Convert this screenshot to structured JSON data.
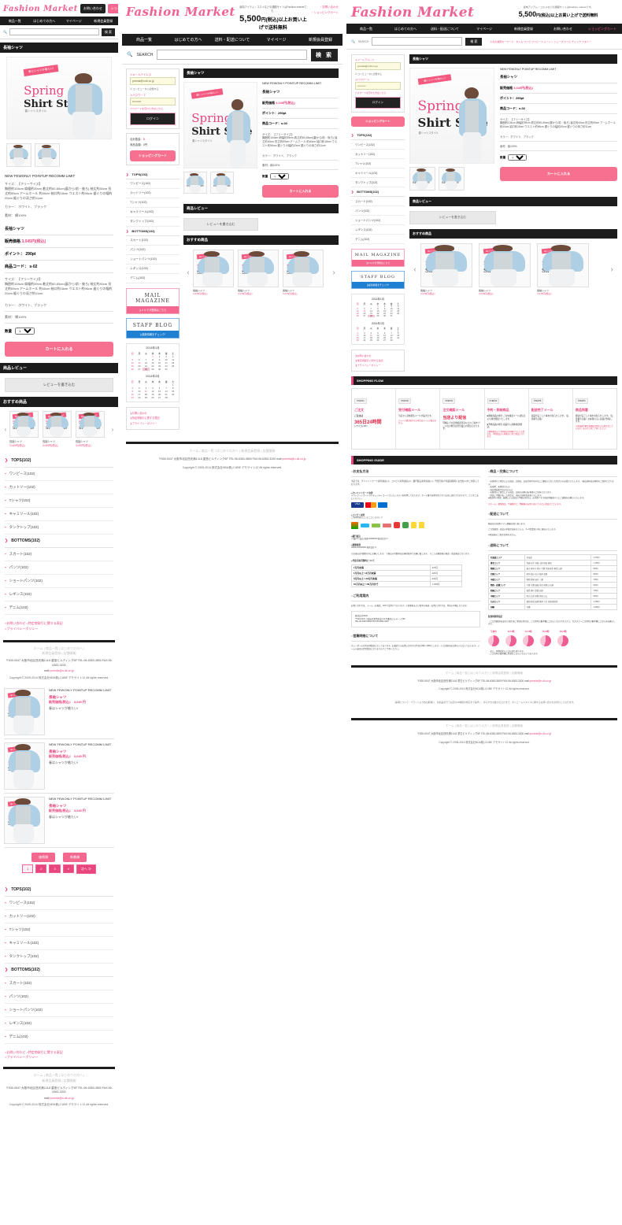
{
  "site": {
    "logo": "Fashion Market",
    "tagline": "最旬アイテム・コスメなどの通販サイトはFashion marketです。",
    "free_shipping_prefix": "5,500",
    "free_shipping_suffix": "円(税込)以上お買い上げで送料無料",
    "contact_link": "お問い合わせ",
    "cart_link": "ショッピングカート"
  },
  "nav": {
    "items_narrow": [
      "商品一覧",
      "はじめての方へ",
      "マイページ",
      "新規会員登録"
    ],
    "items_mid": [
      "商品一覧",
      "はじめての方へ",
      "送料・配送について",
      "マイページ",
      "新規会員登録"
    ],
    "items_wide": [
      "商品一覧",
      "はじめての方へ",
      "送料・配送について",
      "マイページ",
      "新規会員登録",
      "お問い合わせ",
      "ショッピングカート"
    ]
  },
  "search": {
    "label": "SEARCH",
    "placeholder": "",
    "button": "検 索",
    "keywords_label": "人気の検索キーワード：",
    "keywords": "ボトム ワンピ ワンピース ムートン シューズ ワンピ チェック スキニー"
  },
  "login": {
    "email_label": "≫メールアドレス",
    "email_value": "yoneda@n-dk.co.jp",
    "remember_label": "コンピュータに記憶する",
    "password_label": "≫パスワード",
    "password_value": "••••••••••",
    "forgot_link": "パスワードを忘れた方はこちら",
    "button": "ログイン"
  },
  "cart_widget": {
    "count_label": "合計数量：",
    "count_value": "0",
    "total_label": "商品金額：",
    "total_value": "0円",
    "button": "ショッピングカート"
  },
  "product": {
    "section_title": "長袖シャツ",
    "tags": "NEW  FEWONLY  POINTUP  RECOMM  LIMIT",
    "name": "長袖シャツ",
    "price_label": "販売価格",
    "price_value": "3,045円(税込)",
    "point_label": "ポイント：",
    "point_value": "290pt",
    "code_label": "商品コード：",
    "code_value": "s-02",
    "size_label": "サイズ：【フリーサイズ】",
    "size_detail": "胸囲約104cm 肩幅約39cm 着丈約60-65cm(裏から/前・後ろ) 袖丈約40cm 形丈約59cm アームホール 約40cm 袖口約18cm ウエスト約96cm 裾ぐりの幅約20cm 裾ぐりの深さ約11cm",
    "color_label": "カラー：",
    "color_value": "ホワイト、ブラック",
    "material_label": "素材：",
    "material_value": "綿100%",
    "qty_label": "数量",
    "qty_value": "1",
    "cart_button": "カートに入れる",
    "review_header": "商品レビュー",
    "review_button": "レビューを書き込む",
    "image_ribbon": "春にシャツが着たい!",
    "image_title1": "Spring",
    "image_title2": "Shirt Style",
    "image_caption": "春シャツスタイル"
  },
  "recommend": {
    "header": "おすすめ商品",
    "prev": "‹",
    "next": "›",
    "items": [
      {
        "name": "長袖シャツ",
        "price": "3,045円(税込)"
      },
      {
        "name": "長袖シャツ",
        "price": "3,045円(税込)"
      },
      {
        "name": "長袖シャツ",
        "price": "3,045円(税込)"
      }
    ]
  },
  "categories": {
    "tops_head": "TOPS(102)",
    "tops": [
      "ワンピース(102)",
      "カットソー(102)",
      "Tシャツ(102)",
      "キャミソール(102)",
      "タンクトップ(102)"
    ],
    "bottoms_head": "BOTTOMS(102)",
    "bottoms": [
      "スカート(102)",
      "パンツ(102)",
      "ショートパンツ(102)",
      "レギンス(102)",
      "デニム(102)"
    ]
  },
  "info_links": [
    "お問い合わせ",
    "特定商取引に関する表記",
    "プライバシーポリシー"
  ],
  "banners": {
    "mail_title": "MAIL MAGAZINE",
    "mail_sub": "メルマガ登録はこちら",
    "blog_title": "STAFF BLOG",
    "blog_sub": "最新情報をチェック!"
  },
  "calendar": {
    "month1": "2014年1月",
    "month2": "2014年2月",
    "dow": [
      "日",
      "月",
      "火",
      "水",
      "木",
      "金",
      "土"
    ],
    "jan_weeks": [
      [
        "",
        "",
        "",
        "1",
        "2",
        "3",
        "4"
      ],
      [
        "5",
        "6",
        "7",
        "8",
        "9",
        "10",
        "11"
      ],
      [
        "12",
        "13",
        "14",
        "15",
        "16",
        "17",
        "18"
      ],
      [
        "19",
        "20",
        "21",
        "22",
        "23",
        "24",
        "25"
      ],
      [
        "26",
        "27",
        "28",
        "29",
        "30",
        "31",
        ""
      ]
    ],
    "feb_weeks": [
      [
        "",
        "",
        "",
        "",
        "",
        "",
        "1"
      ],
      [
        "2",
        "3",
        "4",
        "5",
        "6",
        "7",
        "8"
      ],
      [
        "9",
        "10",
        "11",
        "12",
        "13",
        "14",
        "15"
      ],
      [
        "16",
        "17",
        "18",
        "19",
        "20",
        "21",
        "22"
      ],
      [
        "23",
        "24",
        "25",
        "26",
        "27",
        "28",
        ""
      ]
    ]
  },
  "listing": {
    "sort_buttons": [
      "価格順",
      "新着順"
    ],
    "pages": [
      "1",
      "2",
      "3",
      "4"
    ],
    "next": "次へ ≫",
    "items": [
      {
        "tags": "NEW  FEWONLY POINTUP  RECOMM  LIMIT",
        "name": "長袖シャツ",
        "price": "販売価格(税込)： 3,045 円",
        "desc": "春はシャツが着たい!"
      },
      {
        "tags": "NEW  FEWONLY POINTUP  RECOMM  LIMIT",
        "name": "長袖シャツ",
        "price": "販売価格(税込)： 3,045 円",
        "desc": "春はシャツが着たい!"
      },
      {
        "tags": "NEW  FEWONLY POINTUP  RECOMM  LIMIT",
        "name": "長袖シャツ",
        "price": "販売価格(税込)： 3,045 円",
        "desc": "春はシャツが着たい!"
      }
    ]
  },
  "shopping_flow": {
    "header": "SHOPPING FLOW",
    "steps": [
      {
        "badge": "STEP01",
        "title": "ご注文",
        "body_strong": "ご注文は",
        "body_big": "365日24時間",
        "body_tail": "いつでもOK!!",
        "body": ""
      },
      {
        "badge": "STEP02",
        "title": "受付確認メール",
        "body": "当店から自動配信メールが届きます。",
        "note": "※メール便が届かない場合はメールが届きません。"
      },
      {
        "badge": "STEP03",
        "title": "注文確認メール",
        "big": "当店より配信",
        "body": "同梱子での送金確認済みなどのご案内 ※この日の場合は翌営業日の配信となります。"
      },
      {
        "badge": "STEP04",
        "title": "予約・即納商品",
        "body": "■即納商品の場合 ご注文確認メール送信日より順次発送いたします。\n\n■予約商品の場合 商品が入荷後/順次発送。",
        "note": "※即納商品より予約商品が同梱されている場合は、予約商品が入荷後まとめて商品となります。"
      },
      {
        "badge": "STEP05",
        "title": "配送完了メール",
        "body": "商品が完了した事をお知らせします。（伝票番号記載）"
      },
      {
        "badge": "STEP06",
        "title": "商品到着",
        "body": "発送が完了した事をお知らせします。（伝票番号記載）お客様の元に商品が到着します。",
        "note": "※発送後予期せぬ遅延が発生する場合がございます。あらかじめご了承ください。"
      }
    ]
  },
  "shopping_guide": {
    "header": "SHOPPING GUIDE",
    "pay_head": "お支払方法",
    "pay_intro": "当店では、クレジットカード決済(先払い)、コンビニ決済(先払い)、銀行振込決済(先払い)、代金引換(※商品到着時にお支払い)をご用意しております。",
    "pay_cc_head": "●クレジットカード決済",
    "pay_cc_body": "※クレジットカードのセキュリティコードなしのシステムを利用しております。カード番号は暗号化されて安全に送信されますので、どうぞご安心ください。",
    "pay_conv_head": "●コンビニ決済",
    "pay_conv_body": "ご利用可能なコンビニエンスストア",
    "pay_bank_head": "●銀行振込",
    "pay_bank_body": "××銀行××支店 普通 00000000 株式会社××",
    "pay_post_head": "●郵便振替",
    "pay_post_body": "00000-00000000 株式会社××",
    "pay_notes": "※お振込は1週間以内にお願いします。 ※振込み手数料はお客様負担でお願い致します。 ※ご入金確認後の発送・商品発送となります。",
    "cod_head": "●代金引換手数料について",
    "cod_table": [
      [
        "1万円未満",
        "315円"
      ],
      [
        "1万円以上～3万円未満",
        "420円"
      ],
      [
        "3万円以上～10万円未満",
        "630円"
      ],
      [
        "10万円以上～30万円まで",
        "1,050円"
      ]
    ],
    "contact_head": "ご利用案内",
    "contact_body": "お問い合わせは、メール、お電話、FAXで受付けております。※日曜日および日中の発送・お問い合わせは、翌日の手配になります。",
    "contact_card": "株式会社NDAI\n〒530-0047 大阪市北区西天満 2-6-8 重島ビルディング6F\nTEL:06-6363-3800  FAX:06-6363-3200",
    "hours_head": "営業時間について",
    "hours_body": "カレンダーの赤丸は休業日となっております。お電話でのお問い合わせは平日の9時～18時とします。※土日祝日はお休みいただいております。メールの返信は翌営業日となりますのでご了承ください。",
    "goods_head": "商品・交換について",
    "goods_body": "・お客様のご都合による返品、交換は、お届け後7日以内にご連絡いただいた場合のみお受けいたします。（返品送料はお客様のご負担となります）\n・未使用、未開封のもの\n・商品到着後7日以内のもの\n・お客様のご都合による返品、交換の送料はお客様のご負担となります。\n・商品に不備があった場合は、当店が送料を負担いたします。\n●配送中の事故・破損による商品の不備の場合は、お手数ですが商品到着後すぐにご連絡をお願いいたします。",
    "goods_note": "※セール、福袋商品、下着類など、開梱後のお取り扱いできない商品がございます。",
    "ship_head": "配送について",
    "ship_body": "配送は宅急便(ヤマト運輸)を取り扱います。\n\nご注文確認・商品の手配が出来ましたら、3～5営業日以内に発送いたします。\n\n※発送後のご指定は承れません。",
    "ship_fee_head": "送料について",
    "ship_fee_rows": [
      [
        "北海道エリア",
        "北海道",
        "1,575円"
      ],
      [
        "東北エリア",
        "青森 岩手 宮城 山形 秋田 福島",
        "1,155円"
      ],
      [
        "関東エリア",
        "東京 神奈川 埼玉 千葉 茨城 栃木 群馬 山梨",
        "840円"
      ],
      [
        "北陸エリア",
        "新潟 富山 石川 福井 長野",
        "840円"
      ],
      [
        "中部エリア",
        "静岡 愛知 岐阜 三重",
        "735円"
      ],
      [
        "関西・近畿エリア",
        "大阪 京都 滋賀 奈良 和歌山 兵庫",
        "630円"
      ],
      [
        "四国エリア",
        "徳島 香川 愛媛 高知",
        "735円"
      ],
      [
        "中国エリア",
        "岡山 広島 島根 鳥取 山口",
        "630円"
      ],
      [
        "九州エリア",
        "福岡 佐賀 長崎 熊本 大分 宮崎 鹿児島",
        "1,365円"
      ],
      [
        "沖縄",
        "沖縄",
        "1,680円"
      ]
    ],
    "time_head": "配達時間帯指定",
    "time_note": "・ご注文確認(お届けの指定)をご希望の場合は、ご注文時の備考欄にご記入いただけますよう、カスタマーご注文時の備考欄にご記入をお願いします。",
    "time_slots": [
      "午前中",
      "12-14時",
      "14-16時",
      "16-18時",
      "18-21時"
    ],
    "time_tail": "・また、時間指定も上記の通り承ります。\n・ご注文時の備考欄に希望をご記入いただいております。"
  },
  "footer": {
    "links": [
      "ホーム",
      "商品一覧",
      "はじめての方へ",
      "新規会員登録",
      "店舗情報"
    ],
    "address": "〒530-0047 大阪市北区西天満2-6-8 重島ビルディング6F  TEL:06-6363-3800 FAX:06-6363-3200",
    "mail_label": "mail:",
    "mail": "yoneda@n-dk.co.jp",
    "copyright": "Copyright © 2005-2014 株式会社NDA株)-CUBE デモサイト12 All rights reserved.",
    "note": "（事項について）ブランドより各お取扱い、新商品を行うお店の24時間の対応まで素早く、ゆるやかな動きの上げまで、ボリュームスタイルに関するお問い合わせお待ちしております。"
  }
}
